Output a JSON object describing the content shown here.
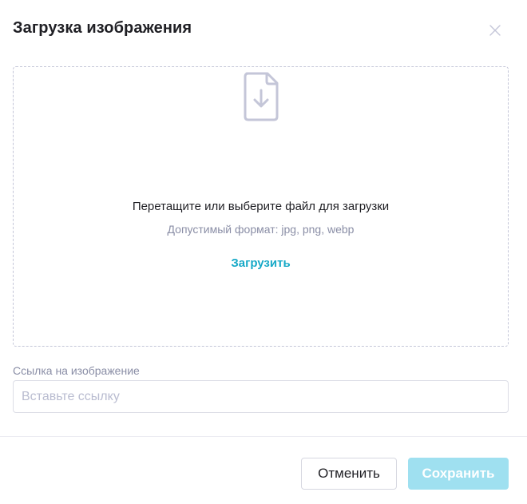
{
  "modal": {
    "title": "Загрузка изображения",
    "close_icon": "close-icon"
  },
  "dropzone": {
    "icon": "file-download-icon",
    "main_text": "Перетащите или выберите файл для загрузки",
    "hint_text": "Допустимый формат: jpg, png, webp",
    "upload_label": "Загрузить"
  },
  "link_field": {
    "label": "Ссылка на изображение",
    "placeholder": "Вставьте ссылку",
    "value": ""
  },
  "footer": {
    "cancel_label": "Отменить",
    "save_label": "Сохранить"
  },
  "colors": {
    "accent": "#17a9c7",
    "save_disabled_bg": "#9fe0f0",
    "icon": "#c4c6d8"
  }
}
